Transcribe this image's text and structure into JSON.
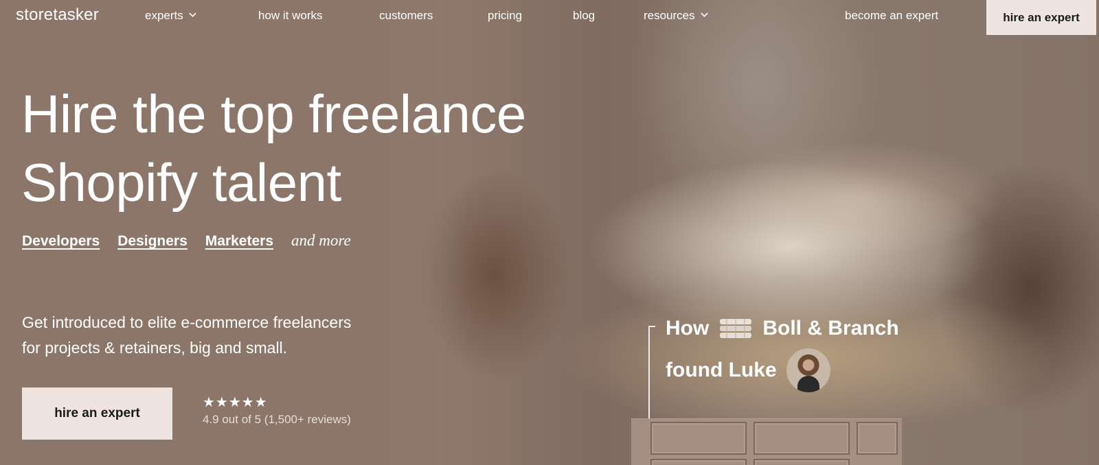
{
  "nav": {
    "logo": "storetasker",
    "items": [
      {
        "label": "experts",
        "has_dropdown": true
      },
      {
        "label": "how it works",
        "has_dropdown": false
      },
      {
        "label": "customers",
        "has_dropdown": false
      },
      {
        "label": "pricing",
        "has_dropdown": false
      },
      {
        "label": "blog",
        "has_dropdown": false
      },
      {
        "label": "resources",
        "has_dropdown": true
      }
    ],
    "become_expert": "become an expert",
    "cta": "hire an expert"
  },
  "hero": {
    "title_line1": "Hire the top freelance",
    "title_line2": "Shopify talent",
    "categories": [
      "Developers",
      "Designers",
      "Marketers"
    ],
    "and_more": "and more",
    "subtext_line1": "Get introduced to elite e-commerce freelancers",
    "subtext_line2": "for projects & retainers, big and small.",
    "cta": "hire an expert",
    "stars": "★★★★★",
    "rating_text": "4.9 out of 5 (1,500+ reviews)"
  },
  "story": {
    "word_how": "How",
    "brand": "Boll & Branch",
    "found": "found Luke"
  },
  "colors": {
    "cta_bg": "#efe4df",
    "cta_text": "#1a1a1a",
    "bg": "#8f7a6c"
  }
}
